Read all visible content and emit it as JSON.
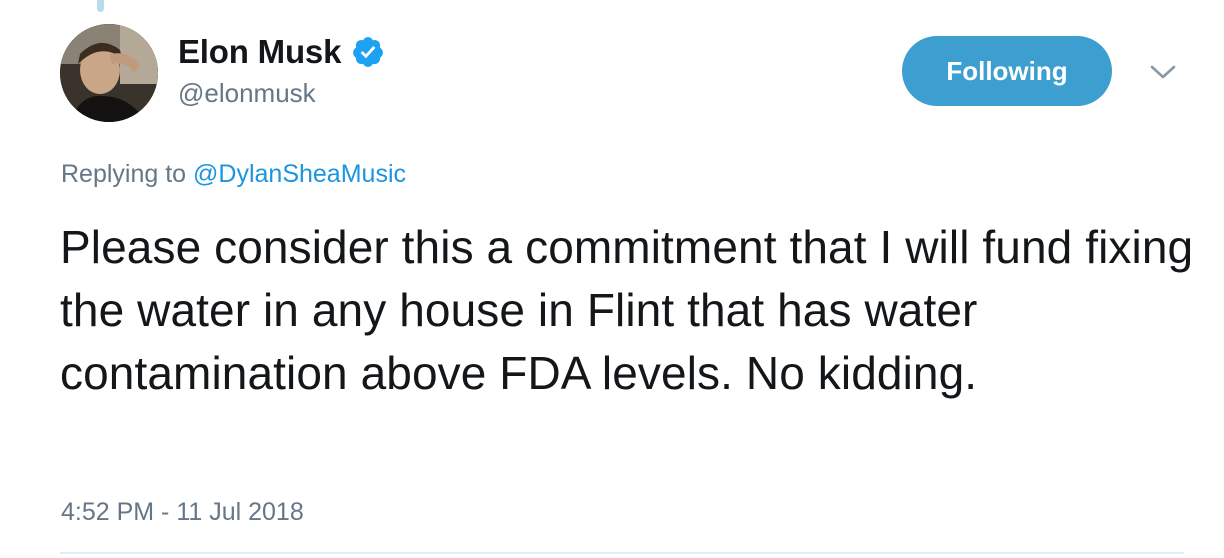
{
  "tweet": {
    "author": {
      "display_name": "Elon Musk",
      "handle": "@elonmusk",
      "verified": true,
      "avatar_icon": "user-avatar-photo"
    },
    "follow_button_label": "Following",
    "reply_prefix": "Replying to",
    "reply_to_handle": "@DylanSheaMusic",
    "text": "Please consider this a commitment that I will fund fixing the water in any house in Flint that has water contamination above FDA levels. No kidding.",
    "timestamp": "4:52 PM - 11 Jul 2018"
  },
  "colors": {
    "accent": "#1b95e0",
    "follow_button": "#3d9fd0",
    "secondary_text": "#657786",
    "primary_text": "#14171a",
    "thread_line": "#b8dcee"
  }
}
